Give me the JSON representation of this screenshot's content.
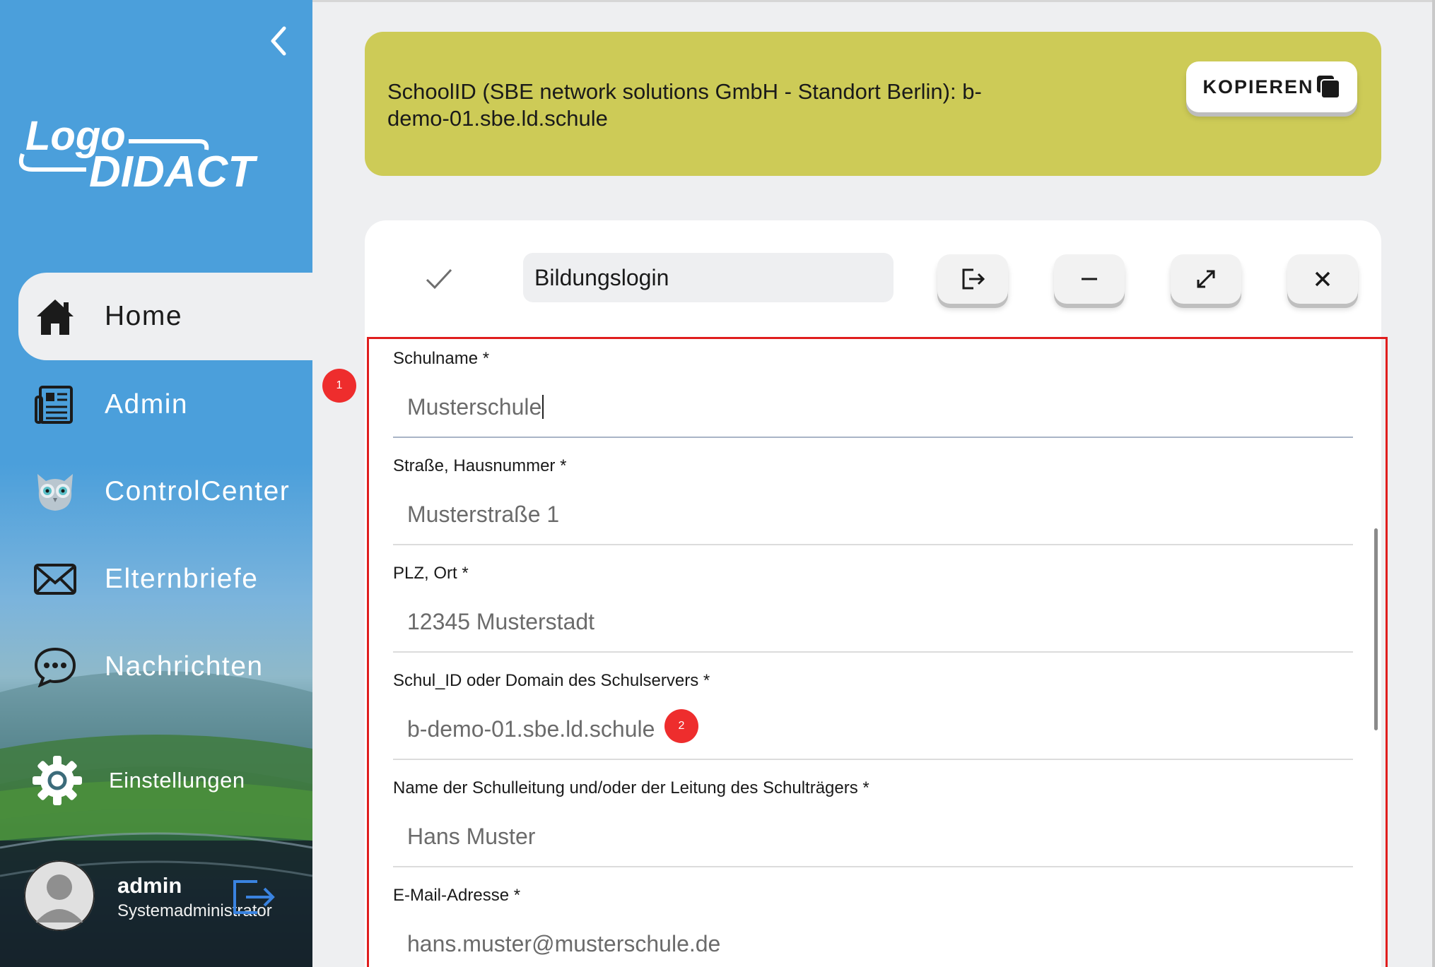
{
  "sidebar": {
    "nav": {
      "home": "Home",
      "admin": "Admin",
      "controlcenter": "ControlCenter",
      "elternbriefe": "Elternbriefe",
      "nachrichten": "Nachrichten",
      "settings": "Einstellungen"
    },
    "user": {
      "name": "admin",
      "role": "Systemadministrator"
    },
    "logo_text": [
      "Logo",
      "DIDACT"
    ]
  },
  "banner": {
    "text": "SchoolID (SBE network solutions GmbH - Standort Berlin): b-demo-01.sbe.ld.schule",
    "copy_label": "KOPIEREN",
    "color": "#cdcb57"
  },
  "card": {
    "name_value": "Bildungslogin"
  },
  "form": {
    "fields": [
      {
        "label": "Schulname *",
        "value": "Musterschule"
      },
      {
        "label": "Straße, Hausnummer *",
        "value": "Musterstraße 1"
      },
      {
        "label": "PLZ, Ort *",
        "value": "12345 Musterstadt"
      },
      {
        "label": "Schul_ID oder Domain des Schulservers *",
        "value": "b-demo-01.sbe.ld.schule"
      },
      {
        "label": "Name der Schulleitung und/oder der Leitung des Schulträgers *",
        "value": "Hans Muster"
      },
      {
        "label": "E-Mail-Adresse *",
        "value": "hans.muster@musterschule.de"
      }
    ]
  },
  "annotations": {
    "badge1": "1",
    "badge2": "2",
    "highlight_color": "#e01e1e"
  },
  "colors": {
    "sidebar_blue": "#4b9fdb",
    "background": "#eeeff1"
  }
}
